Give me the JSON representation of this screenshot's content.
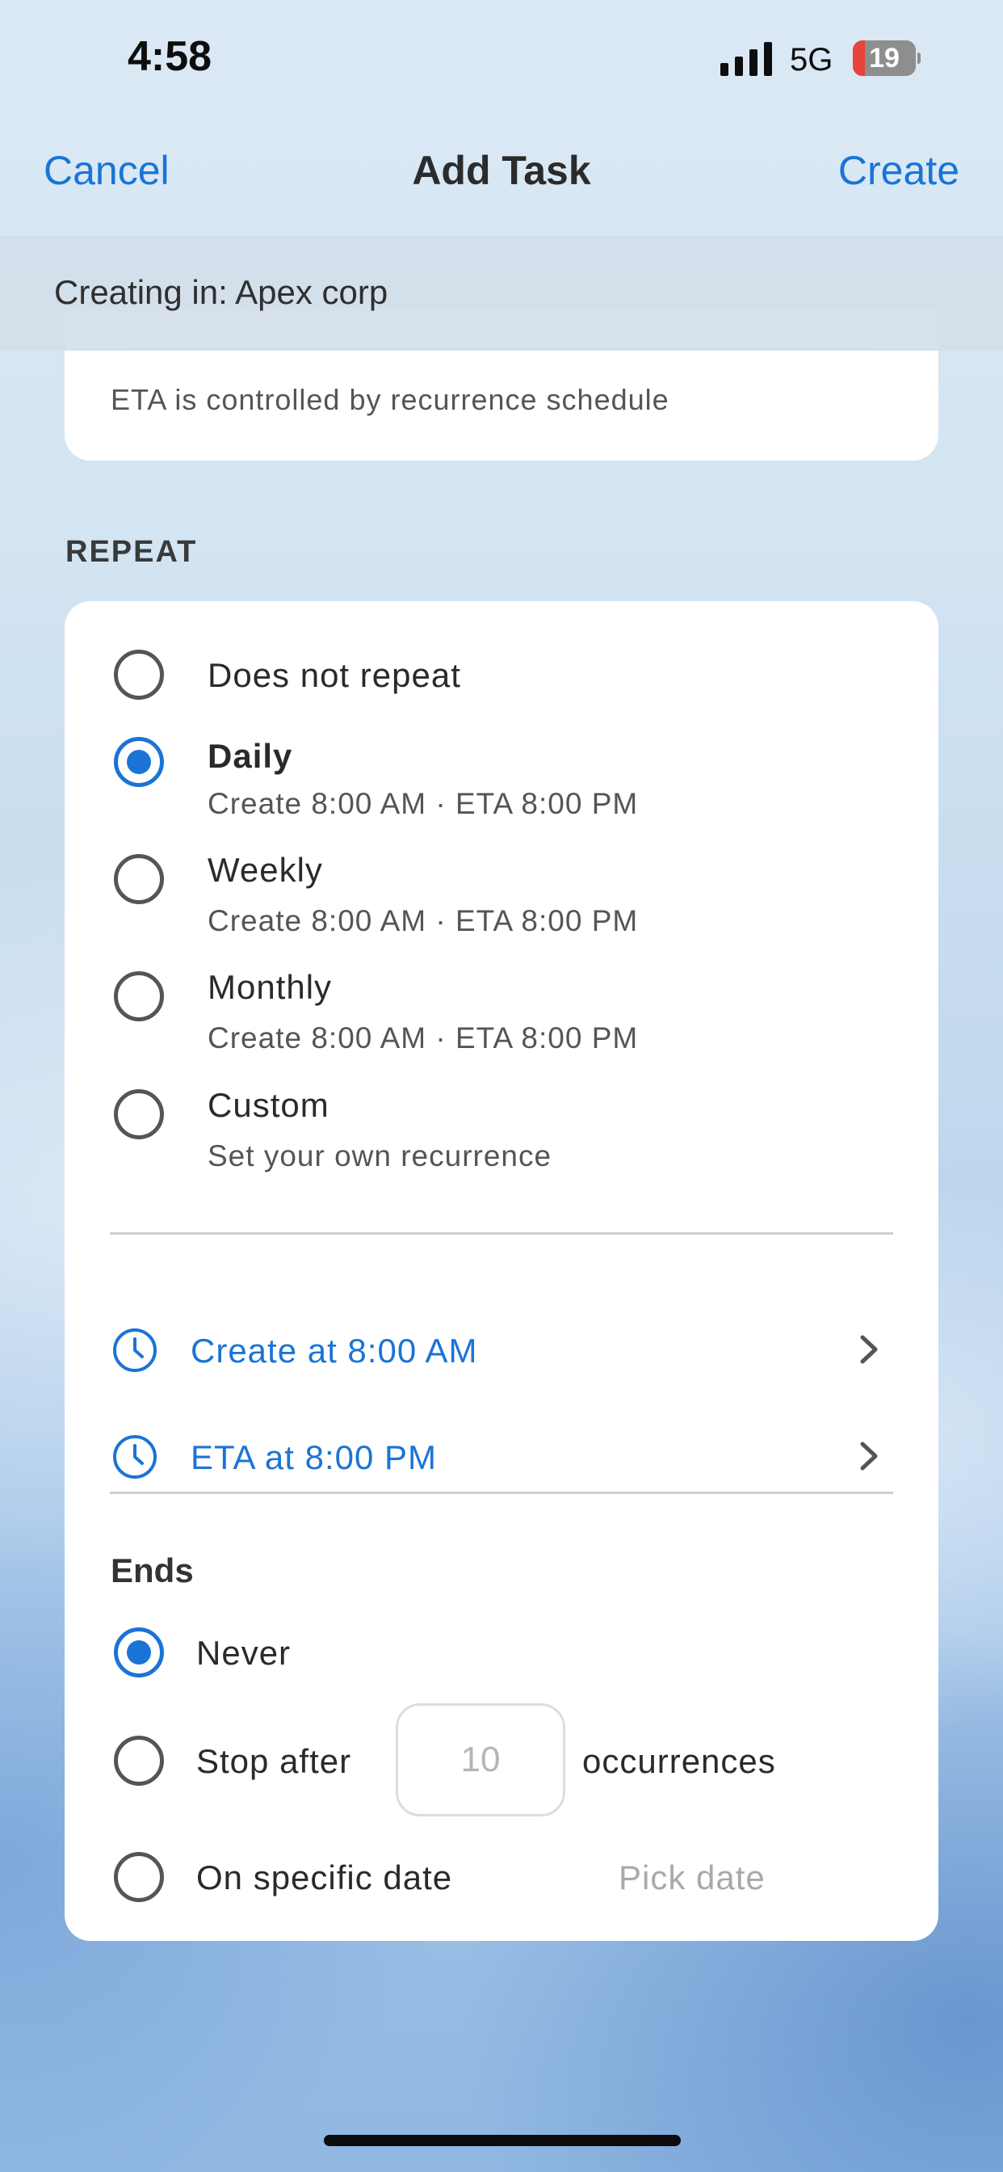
{
  "status_bar": {
    "time": "4:58",
    "network": "5G",
    "battery_level": "19",
    "battery_fraction": 0.19,
    "battery_color": "#e8433d"
  },
  "nav": {
    "cancel_label": "Cancel",
    "title": "Add Task",
    "create_label": "Create"
  },
  "context": {
    "text": "Creating in: Apex corp"
  },
  "eta_card": {
    "note": "ETA is controlled by recurrence schedule"
  },
  "repeat": {
    "heading": "REPEAT",
    "options": [
      {
        "label": "Does not repeat",
        "sub": "",
        "selected": false
      },
      {
        "label": "Daily",
        "sub": "Create 8:00 AM · ETA 8:00 PM",
        "selected": true
      },
      {
        "label": "Weekly",
        "sub": "Create 8:00 AM · ETA 8:00 PM",
        "selected": false
      },
      {
        "label": "Monthly",
        "sub": "Create 8:00 AM · ETA 8:00 PM",
        "selected": false
      },
      {
        "label": "Custom",
        "sub": "Set your own recurrence",
        "selected": false
      }
    ],
    "create_time_label": "Create at 8:00 AM",
    "eta_time_label": "ETA at 8:00 PM",
    "accent_color": "#1a74d6",
    "icons": {
      "time_rows": "clock-icon",
      "disclosure": "chevron-right-icon"
    }
  },
  "ends": {
    "heading": "Ends",
    "never_label": "Never",
    "stop_after_label": "Stop after",
    "occurrences_placeholder": "10",
    "occurrences_label": "occurrences",
    "specific_date_label": "On specific date",
    "pick_date_label": "Pick date",
    "selected": "never"
  }
}
